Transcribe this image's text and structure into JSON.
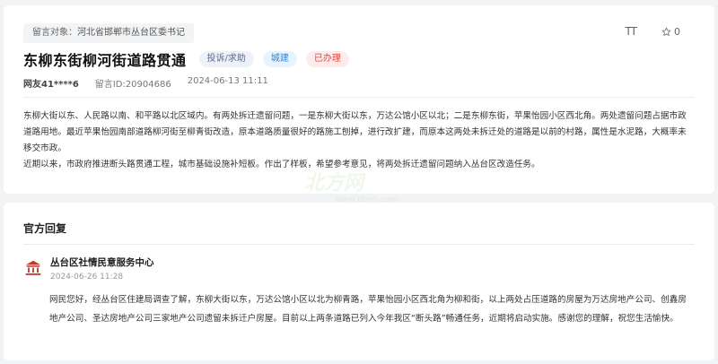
{
  "complaint": {
    "target_label": "留言对象：",
    "target_value": "河北省邯郸市丛台区委书记",
    "title": "东柳东街柳河街道路贯通",
    "badges": {
      "type": "投诉/求助",
      "category": "城建",
      "status": "已办理"
    },
    "user": "网友41****6",
    "message_id": "留言ID:20904686",
    "date": "2024-06-13 11:11",
    "tools": {
      "font_label": "TT",
      "star_count": "0"
    },
    "paragraphs": [
      "东柳大街以东、人民路以南、和平路以北区域内。有两处拆迁遗留问题，一是东柳大街以东，万达公馆小区以北；二是东柳东街，苹果怡园小区西北角。两处遗留问题占据市政道路用地。最近苹果怡园南部道路柳河街至柳青街改造，原本道路质量很好的路施工刨掉，进行改扩建，而原本这两处未拆迁处的道路是以前的村路，属性是水泥路，大概率未移交市政。",
      "近期以来，市政府推进断头路贯通工程，城市基础设施补短板。作出了样板，希望参考意见，将两处拆迁遗留问题纳入丛台区改造任务。"
    ]
  },
  "reply": {
    "heading": "官方回复",
    "org_name": "丛台区社情民意服务中心",
    "time": "2024-06-26 11:28",
    "text": "网民您好，经丛台区住建局调查了解，东柳大街以东，万达公馆小区以北为柳青路，苹果怡园小区西北角为柳和街，以上两处占压道路的房屋为万达房地产公司、创鑫房地产公司、圣达房地产公司三家地产公司遗留未拆迁户房屋。目前以上两条道路已列入今年我区“断头路”畅通任务，近期将启动实施。感谢您的理解，祝您生活愉快。"
  },
  "watermark": {
    "text": "北方网",
    "url": "www.tjbnh.com"
  },
  "colors": {
    "accent_red": "#e0463e",
    "accent_blue": "#2b86d6",
    "icon_red": "#c0392b"
  }
}
